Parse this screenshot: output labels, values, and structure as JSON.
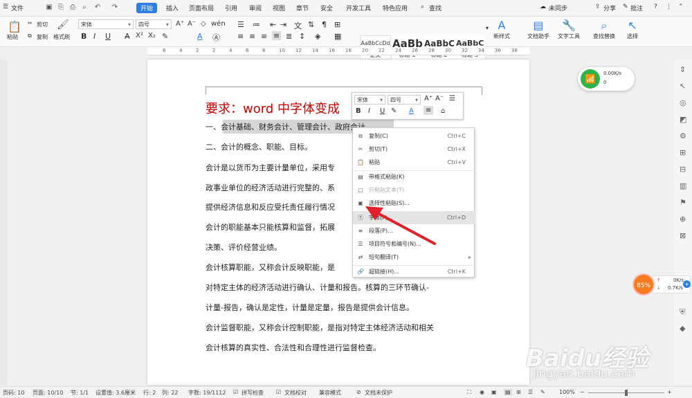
{
  "titlebar": {
    "file_menu": "文件",
    "tabs": [
      "开始",
      "插入",
      "页面布局",
      "引用",
      "审阅",
      "视图",
      "章节",
      "安全",
      "开发工具",
      "特色应用"
    ],
    "search": "查找",
    "sync": "未同步",
    "share": "分享",
    "comment": "批注"
  },
  "ribbon": {
    "paste": "粘贴",
    "cut": "剪切",
    "copy": "复制",
    "format_painter": "格式刷",
    "font_name": "宋体",
    "font_size": "四号",
    "styles": [
      {
        "preview": "AaBbCcDd",
        "name": "正文"
      },
      {
        "preview": "AaBb",
        "name": "标题 1"
      },
      {
        "preview": "AaBbC",
        "name": "标题 2"
      },
      {
        "preview": "AaBbC",
        "name": "标题 3"
      }
    ],
    "new_style": "新样式",
    "doc_assistant": "文档助手",
    "text_tools": "文字工具",
    "find_replace": "查找替换",
    "select": "选择"
  },
  "ruler": [
    "6",
    "4",
    "2",
    "2",
    "4",
    "6",
    "8",
    "10",
    "12",
    "14",
    "16",
    "18",
    "20",
    "22",
    "24",
    "26",
    "28",
    "30",
    "32",
    "34",
    "36",
    "38"
  ],
  "document": {
    "title": "要求：word 中字体变成",
    "lines": [
      "一、会计基础、财务会计、管理会计、政府会计",
      "二、会计的概念、职能、目标。",
      "会计是以货币为主要计量单位，采用专",
      "政事业单位的经济活动进行完整的、系",
      "提供经济信息和反应受托责任履行情况",
      "会计的职能基本只能核算和监督，拓展",
      "决策、评价经营业绩。",
      "会计核算职能，又称会计反映职能，是",
      "对特定主体的经济活动进行确认、计量和报告。核算的三环节确认-",
      "计量-报告，确认是定性，计量是定量，报告是提供会计信息。",
      "会计监督职能，又称会计控制职能，是指对特定主体经济活动和相关",
      "会计核算的真实性、合法性和合理性进行监督检查。"
    ]
  },
  "mini_toolbar": {
    "font_name": "宋体",
    "font_size": "四号"
  },
  "context_menu": [
    {
      "icon": "copy-icon",
      "glyph": "⧉",
      "label": "复制(C)",
      "shortcut": "Ctrl+C",
      "disabled": false
    },
    {
      "icon": "cut-icon",
      "glyph": "✂",
      "label": "剪切(T)",
      "shortcut": "Ctrl+X",
      "disabled": false
    },
    {
      "icon": "paste-icon",
      "glyph": "📋",
      "label": "粘贴",
      "shortcut": "Ctrl+V",
      "disabled": false
    },
    {
      "icon": "paste-format-icon",
      "glyph": "▤",
      "label": "带格式粘贴(K)",
      "shortcut": "",
      "disabled": false
    },
    {
      "icon": "paste-text-icon",
      "glyph": "▢",
      "label": "只粘贴文本(T)",
      "shortcut": "",
      "disabled": true
    },
    {
      "icon": "paste-special-icon",
      "glyph": "▣",
      "label": "选择性粘贴(S)...",
      "shortcut": "",
      "disabled": false
    },
    {
      "icon": "font-icon",
      "glyph": "Ⓣ",
      "label": "字体(F)...",
      "shortcut": "Ctrl+D",
      "disabled": false
    },
    {
      "icon": "paragraph-icon",
      "glyph": "≡",
      "label": "段落(P)...",
      "shortcut": "",
      "disabled": false
    },
    {
      "icon": "bullets-icon",
      "glyph": "☰",
      "label": "项目符号和编号(N)...",
      "shortcut": "",
      "disabled": false
    },
    {
      "icon": "translate-icon",
      "glyph": "⇄",
      "label": "短句翻译(T)",
      "shortcut": "",
      "disabled": false
    },
    {
      "icon": "hyperlink-icon",
      "glyph": "🔗",
      "label": "超链接(H)...",
      "shortcut": "Ctrl+K",
      "disabled": false
    }
  ],
  "status": {
    "page_code": "页码: 10",
    "page": "页面: 10/10",
    "section": "节: 1/1",
    "setting": "设置值: 3.6厘米",
    "row": "行: 2",
    "col": "列: 22",
    "words": "字数: 19/1112",
    "spell": "拼写检查",
    "proof": "文档校对",
    "compat": "兼容模式",
    "protect": "文档未保护",
    "zoom": "100%"
  },
  "net_widget": {
    "up": "0.00K/s",
    "down": "0"
  },
  "speed_widget": {
    "percent": "85%",
    "up": "0K/s",
    "down": "0.7K/s"
  },
  "watermark": {
    "main": "Baidu经验",
    "sub": "jingyan.baidu.com"
  },
  "colors": {
    "accent": "#2e7de1",
    "title_red": "#c00000",
    "arrow_red": "#e0202a"
  }
}
